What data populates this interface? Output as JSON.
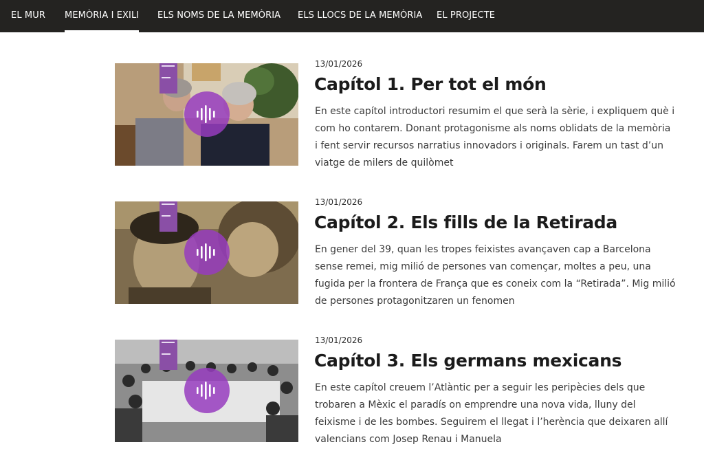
{
  "nav": {
    "items": [
      {
        "label": "EL MUR"
      },
      {
        "label": "MEMÒRIA I EXILI",
        "active": true
      },
      {
        "label": "ELS NOMS DE LA MEMÒRIA"
      },
      {
        "label": "ELS LLOCS DE LA MEMÒRIA"
      },
      {
        "label": "EL PROJECTE"
      }
    ]
  },
  "colors": {
    "nav_bg": "#242321",
    "accent_purple": "#8a4fa6",
    "play_button": "#9a3cbe"
  },
  "episodes": [
    {
      "date": "13/01/2026",
      "title": "Capítol 1. Per tot el món",
      "description": "En este capítol introductori resumim el que serà la sèrie, i expliquem què i com ho contarem. Donant protagonisme als noms oblidats de la memòria i fent servir recursos narratius innovadors i originals. Farem un tast d’un viatge de milers de quilòmet",
      "thumbnail_icon": "audio-waveform-icon"
    },
    {
      "date": "13/01/2026",
      "title": "Capítol 2. Els fills de la Retirada",
      "description": "En gener del 39, quan les tropes feixistes avançaven cap a Barcelona sense remei, mig milió de persones van començar, moltes a peu, una fugida per la frontera de França que es coneix com la “Retirada”. Mig milió de persones protagonitzaren un fenomen",
      "thumbnail_icon": "audio-waveform-icon"
    },
    {
      "date": "13/01/2026",
      "title": "Capítol 3. Els germans mexicans",
      "description": "En este capítol creuem l’Atlàntic per a seguir les peripècies dels que trobaren a Mèxic el paradís on emprendre una nova vida, lluny del feixisme i de les bombes. Seguirem el llegat i l’herència que deixaren allí valencians com Josep Renau i Manuela",
      "thumbnail_icon": "audio-waveform-icon"
    }
  ]
}
